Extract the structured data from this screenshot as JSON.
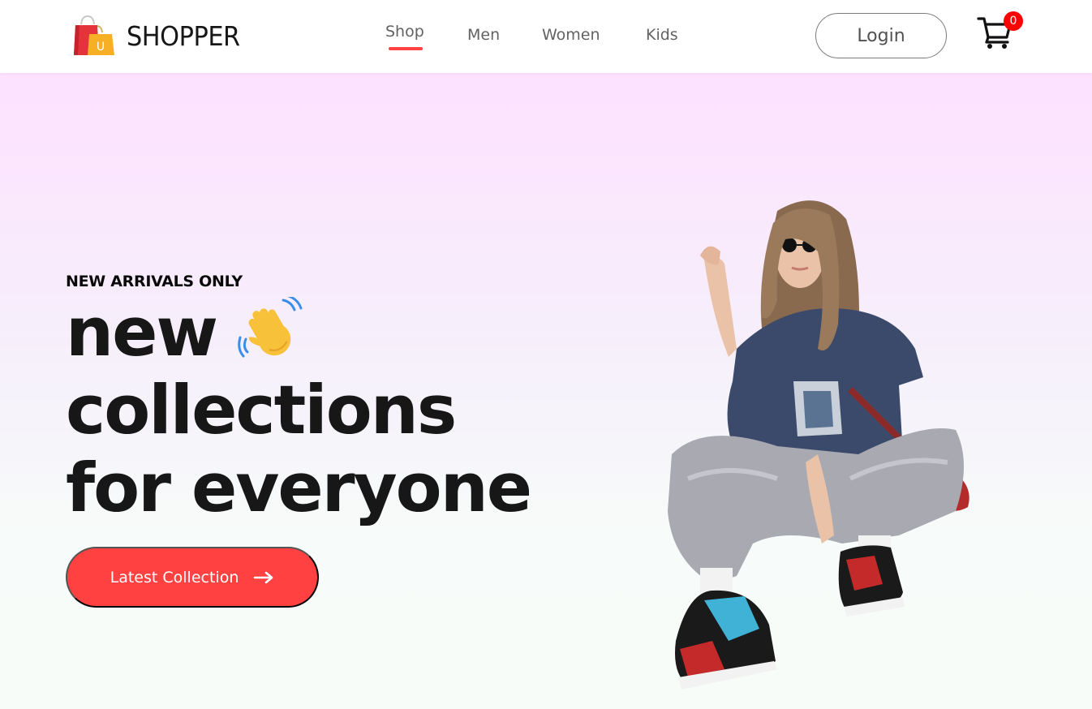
{
  "navbar": {
    "brand": {
      "name": "SHOPPER",
      "logo_letter": "U",
      "icon": "shopping-bag-logo"
    },
    "menu": [
      {
        "label": "Shop",
        "active": true
      },
      {
        "label": "Men",
        "active": false
      },
      {
        "label": "Women",
        "active": false
      },
      {
        "label": "Kids",
        "active": false
      }
    ],
    "login_label": "Login",
    "cart": {
      "icon": "cart-icon",
      "count": "0"
    }
  },
  "hero": {
    "kicker": "NEW ARRIVALS ONLY",
    "headline": [
      "new",
      "collections",
      "for everyone"
    ],
    "hand_icon": "waving-hand-icon",
    "cta_label": "Latest Collection",
    "cta_icon": "arrow-right-icon",
    "image": "model-photo"
  },
  "colors": {
    "accent": "#ff4141",
    "badge": "#ff0000",
    "gradient_top": "#fde1ff",
    "gradient_bottom": "#f7fcf9",
    "text": "#171717",
    "nav_text": "#626262"
  }
}
